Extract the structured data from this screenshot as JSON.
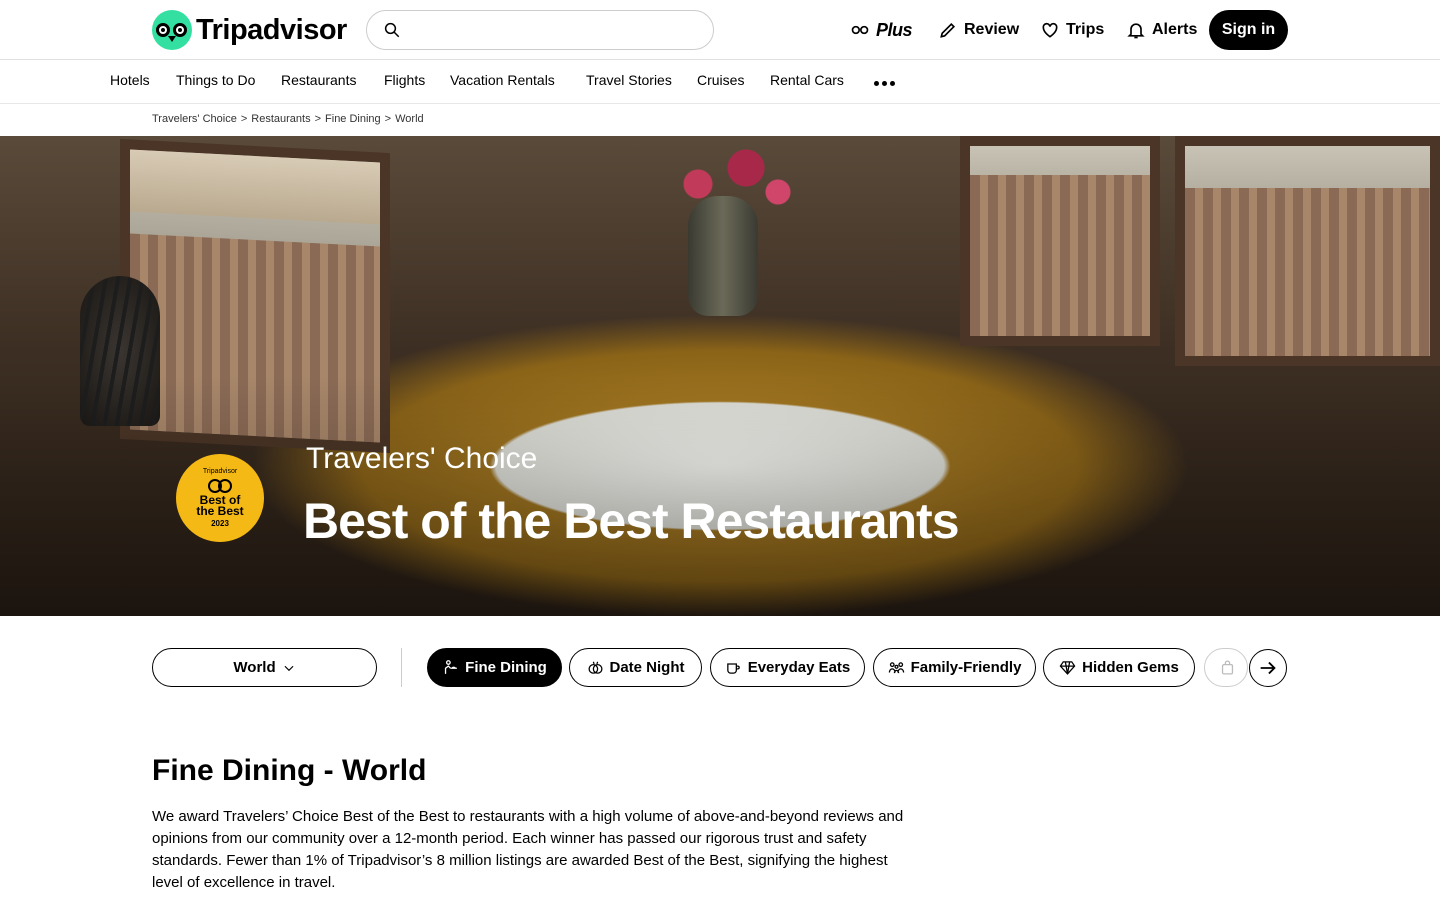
{
  "header": {
    "logo_text": "Tripadvisor",
    "search_placeholder": "",
    "plus_label": "Plus",
    "review_label": "Review",
    "trips_label": "Trips",
    "alerts_label": "Alerts",
    "signin_label": "Sign in"
  },
  "nav": {
    "items": [
      "Hotels",
      "Things to Do",
      "Restaurants",
      "Flights",
      "Vacation Rentals",
      "Travel Stories",
      "Cruises",
      "Rental Cars"
    ]
  },
  "breadcrumb": {
    "items": [
      "Travelers' Choice",
      "Restaurants",
      "Fine Dining",
      "World"
    ],
    "separator": ">"
  },
  "hero": {
    "kicker": "Travelers' Choice",
    "title": "Best of the Best Restaurants",
    "badge": {
      "brand": "Tripadvisor",
      "line1": "Best of",
      "line2": "the Best",
      "year": "2023",
      "color": "#f5b915"
    }
  },
  "filters": {
    "geo_selected": "World",
    "chips": [
      {
        "label": "Fine Dining",
        "icon": "waiter-icon",
        "active": true
      },
      {
        "label": "Date Night",
        "icon": "rings-icon",
        "active": false
      },
      {
        "label": "Everyday Eats",
        "icon": "coffee-cup-icon",
        "active": false
      },
      {
        "label": "Family-Friendly",
        "icon": "family-icon",
        "active": false
      },
      {
        "label": "Hidden Gems",
        "icon": "gem-icon",
        "active": false
      }
    ]
  },
  "section": {
    "title": "Fine Dining - World",
    "description": "We award Travelers’ Choice Best of the Best to restaurants with a high volume of above-and-beyond reviews and opinions from our community over a 12-month period. Each winner has passed our rigorous trust and safety standards. Fewer than 1% of Tripadvisor’s 8 million listings are awarded Best of the Best, signifying the highest level of excellence in travel."
  },
  "colors": {
    "brand_green": "#34e0a1",
    "badge_gold": "#f5b915",
    "active_chip": "#000000"
  }
}
